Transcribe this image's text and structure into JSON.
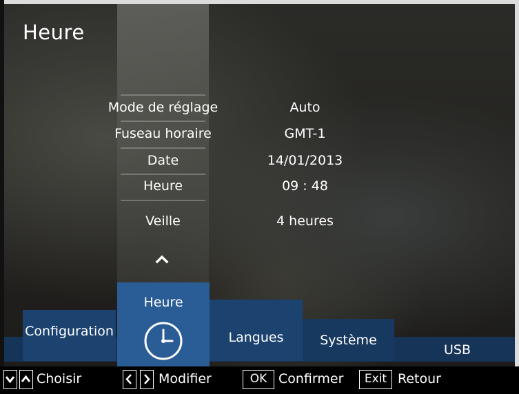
{
  "header": {
    "title": "Heure"
  },
  "settings": {
    "rows": [
      {
        "label": "Mode de réglage",
        "value": "Auto"
      },
      {
        "label": "Fuseau horaire",
        "value": "GMT-1"
      },
      {
        "label": "Date",
        "value": "14/01/2013"
      },
      {
        "label": "Heure",
        "value": "09 : 48"
      },
      {
        "label": "Veille",
        "value": "4 heures"
      }
    ]
  },
  "tabs": {
    "configuration": "Configuration",
    "heure": "Heure",
    "langues": "Langues",
    "systeme": "Système",
    "usb": "USB",
    "selected": "Heure"
  },
  "footer": {
    "choose_label": "Choisir",
    "modify_label": "Modifier",
    "ok_key": "OK",
    "confirm_label": "Confirmer",
    "exit_key": "Exit",
    "back_label": "Retour"
  },
  "icons": {
    "scroll_up": "chevron-up-icon",
    "heure_tab": "clock-icon",
    "nav_down": "arrow-down-key-icon",
    "nav_up": "arrow-up-key-icon",
    "nav_left": "arrow-left-key-icon",
    "nav_right": "arrow-right-key-icon"
  },
  "colors": {
    "selected_tab": "#2a5d96",
    "tab": "#1c4370",
    "tab_strip": "#163457"
  }
}
